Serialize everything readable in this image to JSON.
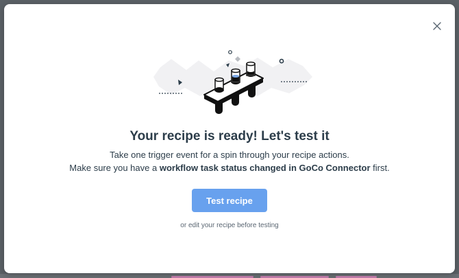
{
  "modal": {
    "title": "Your recipe is ready! Let's test it",
    "line1": "Take one trigger event for a spin through your recipe actions.",
    "line2_prefix": "Make sure you have a ",
    "line2_bold": "workflow task status changed in GoCo Connector",
    "line2_suffix": " first.",
    "test_button_label": "Test recipe",
    "edit_link_text": "or edit your recipe before testing",
    "close_icon": "close-icon",
    "illustration_icon": "test-tubes-illustration"
  },
  "colors": {
    "primary_button": "#68a1ee",
    "title_text": "#2c3d4a",
    "backdrop": "#5b6166"
  }
}
